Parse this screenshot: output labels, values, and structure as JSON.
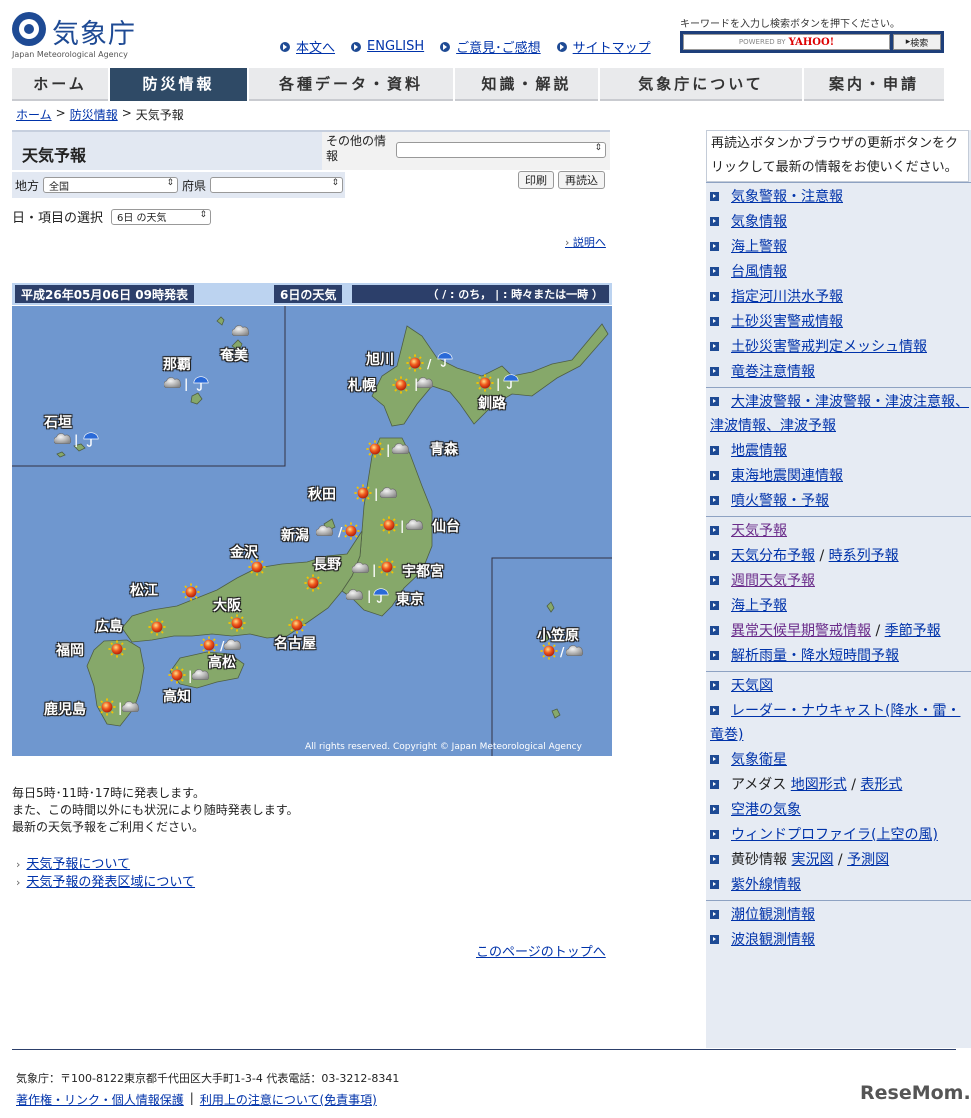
{
  "header": {
    "logo_title": "気象庁",
    "logo_sub": "Japan Meteorological Agency",
    "top_links": [
      "本文へ",
      "ENGLISH",
      "ご意見･ご感想",
      "サイトマップ"
    ],
    "search_hint": "キーワードを入力し検索ボタンを押下ください。",
    "search_powered": "POWERED BY",
    "search_brand": "YAHOO!",
    "search_button": "検索"
  },
  "nav": {
    "tabs": [
      "ホーム",
      "防災情報",
      "各種データ・資料",
      "知識・解説",
      "気象庁について",
      "案内・申請"
    ]
  },
  "breadcrumb": [
    "ホーム",
    "防災情報",
    "天気予報"
  ],
  "main": {
    "title": "天気予報",
    "other_info_label": "その他の情報",
    "region_label": "地方",
    "region_value": "全国",
    "pref_label": "府県",
    "print_button": "印刷",
    "reload_button": "再読込",
    "item_select_label": "日・項目の選択",
    "item_select_value": "6日 の天気",
    "explain_link": "説明へ",
    "map_issued": "平成26年05月06日 09時発表",
    "map_day": "6日の天気",
    "map_legend": "（ / : のち， | : 時々または一時 ）",
    "map_copyright": "All rights reserved. Copyright © Japan Meteorological Agency",
    "cities": [
      "旭川",
      "札幌",
      "釧路",
      "那覇",
      "奄美",
      "石垣",
      "青森",
      "秋田",
      "仙台",
      "新潟",
      "金沢",
      "長野",
      "宇都宮",
      "東京",
      "松江",
      "大阪",
      "広島",
      "福岡",
      "高松",
      "名古屋",
      "高知",
      "鹿児島",
      "小笠原"
    ],
    "notes": [
      "毎日5時･11時･17時に発表します。",
      "また、この時間以外にも状況により随時発表します。",
      "最新の天気予報をご利用ください。"
    ],
    "related_links": [
      "天気予報について",
      "天気予報の発表区域について"
    ],
    "page_top": "このページのトップへ"
  },
  "sidebar": {
    "note": "再読込ボタンかブラウザの更新ボタンをクリックして最新の情報をお使いください。",
    "groups": [
      [
        "気象警報・注意報",
        "気象情報",
        "海上警報",
        "台風情報",
        "指定河川洪水予報",
        "土砂災害警戒情報",
        "土砂災害警戒判定メッシュ情報",
        "竜巻注意情報"
      ],
      [
        "大津波警報・津波警報・津波注意報、津波情報、津波予報",
        "地震情報",
        "東海地震関連情報",
        "噴火警報・予報"
      ],
      [
        "天気予報",
        "天気分布予報",
        "時系列予報",
        "週間天気予報",
        "海上予報",
        "異常天候早期警戒情報",
        "季節予報",
        "解析雨量・降水短時間予報"
      ],
      [
        "天気図",
        "レーダー・ナウキャスト(降水・雷・竜巻)",
        "気象衛星",
        "アメダス",
        "地図形式",
        "表形式",
        "空港の気象",
        "ウィンドプロファイラ(上空の風)",
        "黄砂情報",
        "実況図",
        "予測図",
        "紫外線情報"
      ],
      [
        "潮位観測情報",
        "波浪観測情報"
      ]
    ]
  },
  "footer": {
    "address": "気象庁：〒100-8122東京都千代田区大手町1-3-4 代表電話：03-3212-8341",
    "links": [
      "著作権・リンク・個人情報保護",
      "利用上の注意について(免責事項)"
    ],
    "separator": "|",
    "watermark": "ReseMom."
  }
}
